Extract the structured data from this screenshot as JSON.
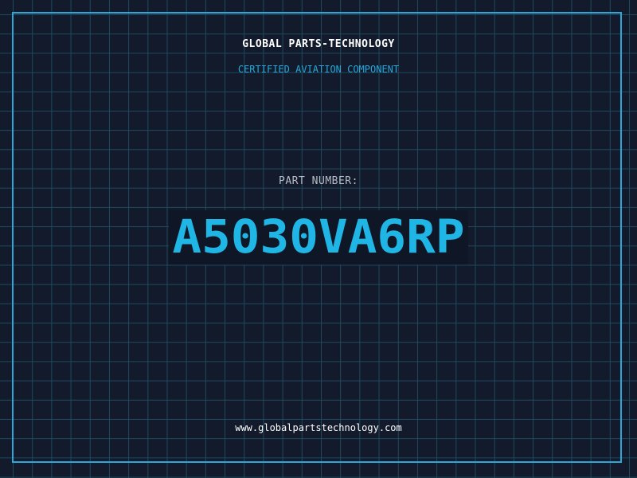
{
  "header": {
    "company": "GLOBAL PARTS-TECHNOLOGY",
    "tagline": "CERTIFIED AVIATION COMPONENT"
  },
  "part": {
    "label": "PART NUMBER:",
    "number": "A5030VA6RP"
  },
  "footer": {
    "url": "www.globalpartstechnology.com"
  },
  "colors": {
    "background": "#121a2c",
    "grid": "#1f4a5e",
    "accent": "#24a8d8",
    "text": "#ffffff"
  }
}
